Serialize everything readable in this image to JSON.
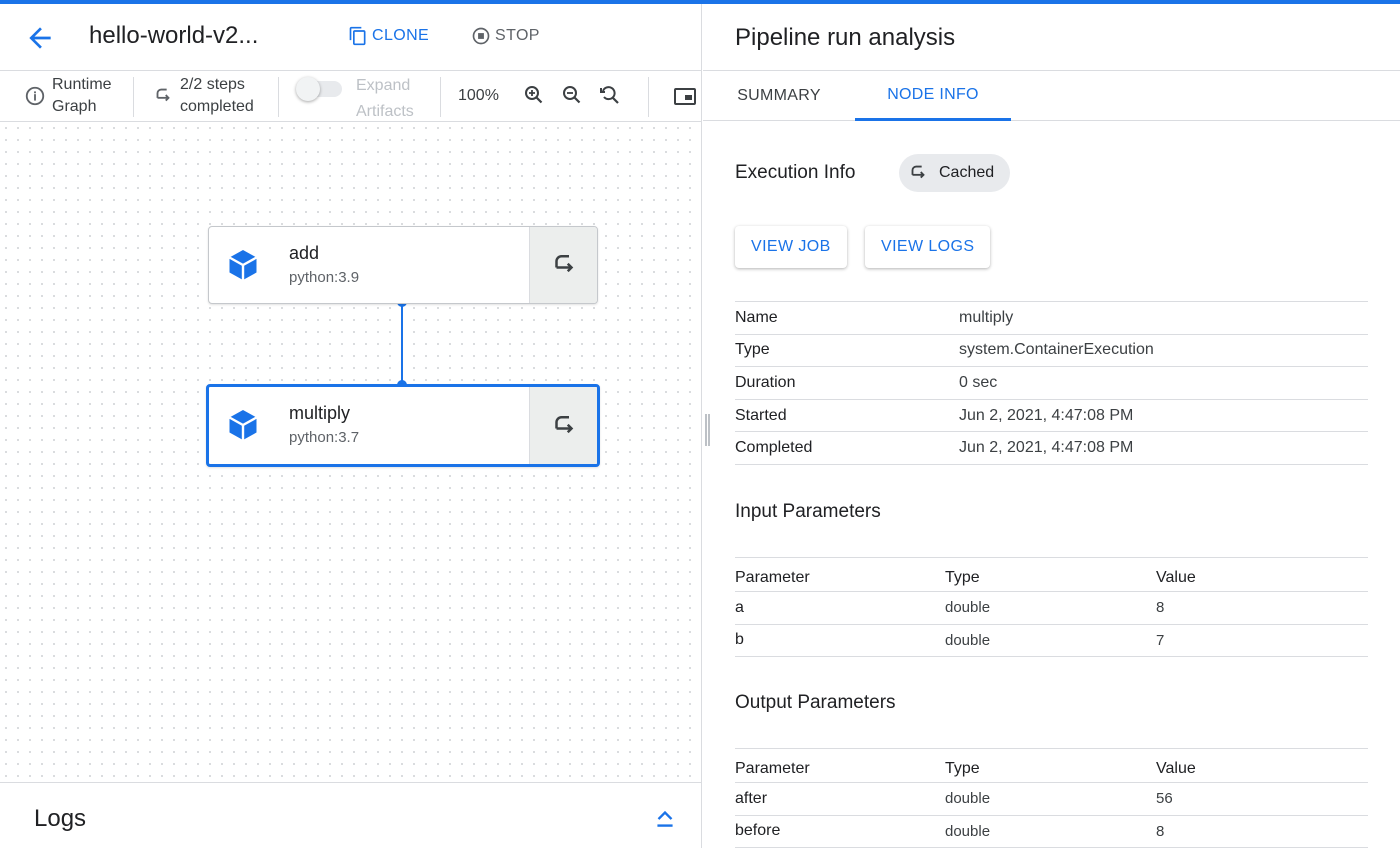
{
  "header": {
    "title": "hello-world-v2...",
    "clone_label": "CLONE",
    "stop_label": "STOP"
  },
  "toolbar": {
    "runtime_graph": [
      "Runtime",
      "Graph"
    ],
    "steps": [
      "2/2 steps",
      "completed"
    ],
    "expand_artifacts": [
      "Expand",
      "Artifacts"
    ],
    "zoom": "100%"
  },
  "graph": {
    "nodes": [
      {
        "name": "add",
        "image": "python:3.9",
        "selected": false
      },
      {
        "name": "multiply",
        "image": "python:3.7",
        "selected": true
      }
    ]
  },
  "logs": {
    "title": "Logs"
  },
  "panel": {
    "title": "Pipeline run analysis",
    "tabs": {
      "summary": "SUMMARY",
      "node_info": "NODE INFO",
      "active": "NODE INFO"
    },
    "execution": {
      "title": "Execution Info",
      "status_chip": "Cached",
      "view_job_label": "VIEW JOB",
      "view_logs_label": "VIEW LOGS",
      "rows": [
        {
          "key": "Name",
          "value": "multiply"
        },
        {
          "key": "Type",
          "value": "system.ContainerExecution"
        },
        {
          "key": "Duration",
          "value": "0 sec"
        },
        {
          "key": "Started",
          "value": "Jun 2, 2021, 4:47:08 PM"
        },
        {
          "key": "Completed",
          "value": "Jun 2, 2021, 4:47:08 PM"
        }
      ]
    },
    "input_parameters": {
      "title": "Input Parameters",
      "headers": [
        "Parameter",
        "Type",
        "Value"
      ],
      "rows": [
        [
          "a",
          "double",
          "8"
        ],
        [
          "b",
          "double",
          "7"
        ]
      ]
    },
    "output_parameters": {
      "title": "Output Parameters",
      "headers": [
        "Parameter",
        "Type",
        "Value"
      ],
      "rows": [
        [
          "after",
          "double",
          "56"
        ],
        [
          "before",
          "double",
          "8"
        ]
      ]
    }
  },
  "colors": {
    "accent": "#1a73e8",
    "text": "#202124",
    "muted": "#5f6368",
    "divider": "#dadce0",
    "chip_bg": "#e8eaed"
  }
}
